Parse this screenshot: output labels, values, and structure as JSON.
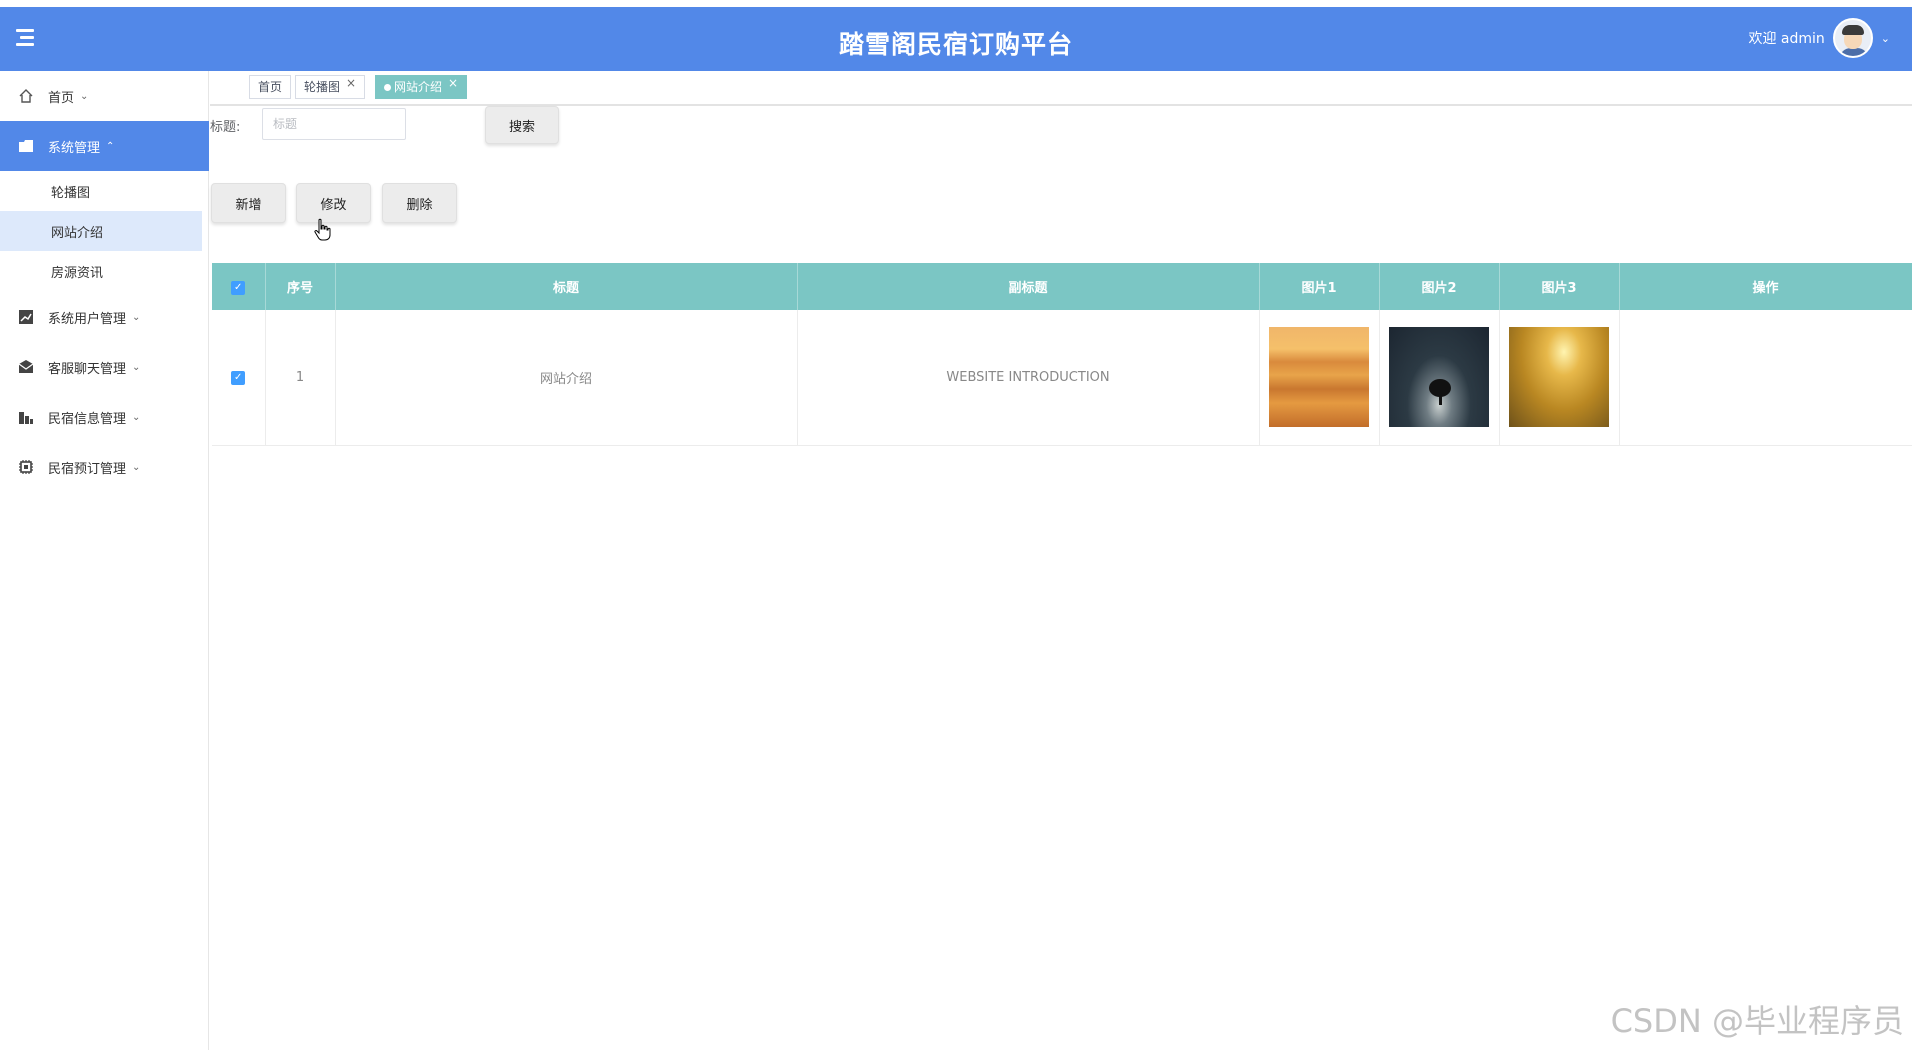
{
  "header": {
    "title": "踏雪阁民宿订购平台",
    "welcome": "欢迎 admin",
    "colors": {
      "header_bg": "#5288e8",
      "accent_teal": "#7bc6c4"
    }
  },
  "sidebar": {
    "items": [
      {
        "label": "首页",
        "icon": "home-icon"
      },
      {
        "label": "系统管理",
        "icon": "folder-icon",
        "active": true
      },
      {
        "label": "系统用户管理",
        "icon": "chart-icon"
      },
      {
        "label": "客服聊天管理",
        "icon": "mail-icon"
      },
      {
        "label": "民宿信息管理",
        "icon": "building-icon"
      },
      {
        "label": "民宿预订管理",
        "icon": "chip-icon"
      }
    ],
    "subitems": [
      {
        "label": "轮播图"
      },
      {
        "label": "网站介绍",
        "active": true
      },
      {
        "label": "房源资讯"
      }
    ]
  },
  "tabs": [
    {
      "label": "首页"
    },
    {
      "label": "轮播图",
      "closable": true
    },
    {
      "label": "网站介绍",
      "closable": true,
      "active": true
    }
  ],
  "search": {
    "label": "标题:",
    "placeholder": "标题",
    "button": "搜索"
  },
  "actions": {
    "add": "新增",
    "edit": "修改",
    "delete": "删除"
  },
  "table": {
    "headers": [
      "序号",
      "标题",
      "副标题",
      "图片1",
      "图片2",
      "图片3",
      "操作"
    ],
    "rows": [
      {
        "index": "1",
        "title": "网站介绍",
        "subtitle": "WEBSITE INTRODUCTION",
        "checked": true
      }
    ]
  },
  "watermark": "CSDN @毕业程序员"
}
